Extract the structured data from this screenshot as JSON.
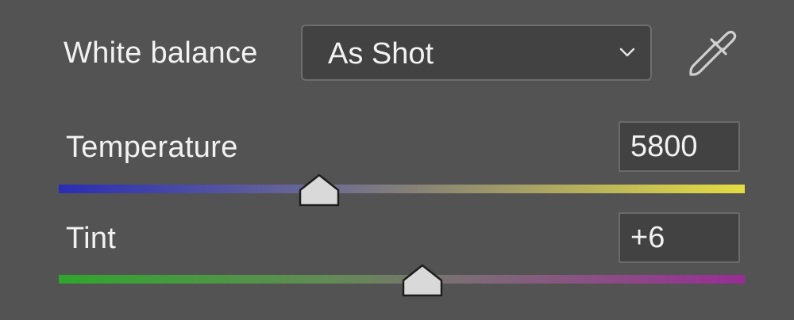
{
  "white_balance": {
    "label": "White balance",
    "selected": "As Shot",
    "dropdown_icon": "chevron-down-icon",
    "tool_icon": "eyedropper-icon"
  },
  "temperature": {
    "label": "Temperature",
    "value": "5800",
    "slider_position_fraction": 0.38,
    "gradient": [
      "#2a2db4",
      "#868276",
      "#e4dd42"
    ]
  },
  "tint": {
    "label": "Tint",
    "value": "+6",
    "slider_position_fraction": 0.53,
    "gradient": [
      "#2fa52d",
      "#7c6e74",
      "#982d95"
    ]
  },
  "colors": {
    "panel_background": "#535353",
    "field_background": "#424242",
    "text": "#f2f2f2"
  }
}
